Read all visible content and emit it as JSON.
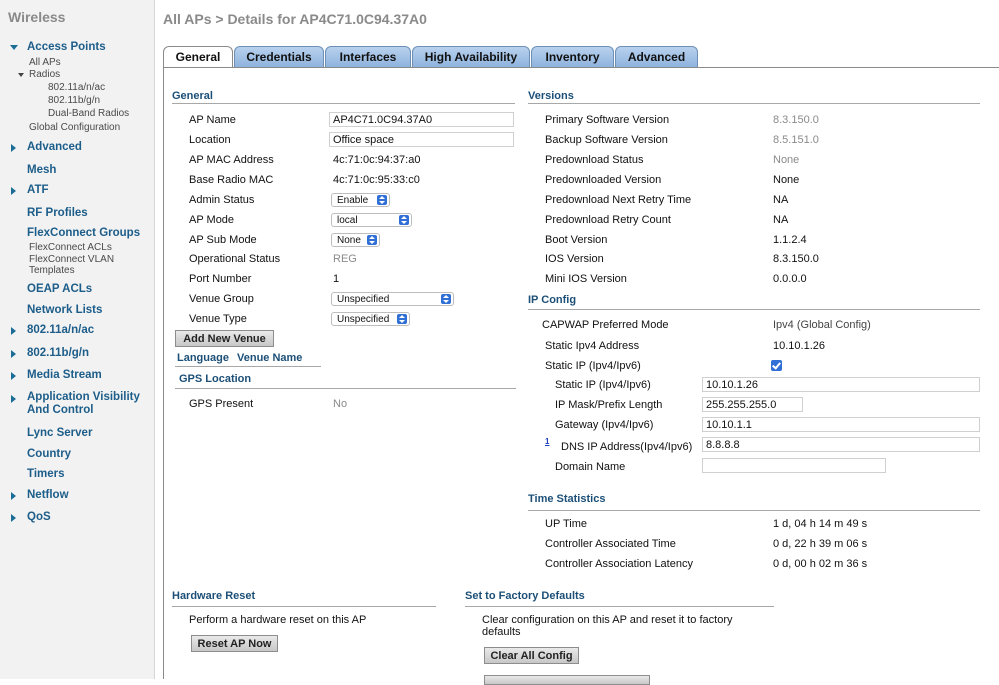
{
  "sidebar": {
    "title": "Wireless",
    "access_points": "Access Points",
    "all_aps": "All APs",
    "radios": "Radios",
    "radio_a": "802.11a/n/ac",
    "radio_b": "802.11b/g/n",
    "dual_band": "Dual-Band Radios",
    "global_config": "Global Configuration",
    "advanced": "Advanced",
    "mesh": "Mesh",
    "atf": "ATF",
    "rf_profiles": "RF Profiles",
    "flexconnect_groups": "FlexConnect Groups",
    "flexconnect_acls": "FlexConnect ACLs",
    "flexconnect_vlan_1": "FlexConnect VLAN",
    "flexconnect_vlan_2": "Templates",
    "oeap_acls": "OEAP ACLs",
    "network_lists": "Network Lists",
    "a_n_ac": "802.11a/n/ac",
    "b_g_n": "802.11b/g/n",
    "media_stream": "Media Stream",
    "avc_1": "Application Visibility",
    "avc_2": "And Control",
    "lync": "Lync Server",
    "country": "Country",
    "timers": "Timers",
    "netflow": "Netflow",
    "qos": "QoS"
  },
  "page_title": "All APs > Details for AP4C71.0C94.37A0",
  "tabs": [
    "General",
    "Credentials",
    "Interfaces",
    "High Availability",
    "Inventory",
    "Advanced"
  ],
  "general": {
    "heading": "General",
    "ap_name_label": "AP Name",
    "ap_name": "AP4C71.0C94.37A0",
    "location_label": "Location",
    "location": "Office space",
    "mac_label": "AP MAC Address",
    "mac": "4c:71:0c:94:37:a0",
    "base_mac_label": "Base Radio MAC",
    "base_mac": "4c:71:0c:95:33:c0",
    "admin_status_label": "Admin Status",
    "admin_status": "Enable",
    "ap_mode_label": "AP Mode",
    "ap_mode": "local",
    "ap_sub_mode_label": "AP Sub Mode",
    "ap_sub_mode": "None",
    "op_status_label": "Operational Status",
    "op_status": "REG",
    "port_label": "Port Number",
    "port": "1",
    "venue_group_label": "Venue Group",
    "venue_group": "Unspecified",
    "venue_type_label": "Venue Type",
    "venue_type": "Unspecified",
    "add_venue_button": "Add New Venue",
    "language_col": "Language",
    "venue_name_col": "Venue Name",
    "gps_heading": "GPS Location",
    "gps_present_label": "GPS Present",
    "gps_present": "No"
  },
  "versions": {
    "heading": "Versions",
    "primary_label": "Primary Software Version",
    "primary": "8.3.150.0",
    "backup_label": "Backup Software Version",
    "backup": "8.5.151.0",
    "predl_status_label": "Predownload Status",
    "predl_status": "None",
    "predl_version_label": "Predownloaded Version",
    "predl_version": "None",
    "predl_next_label": "Predownload Next Retry Time",
    "predl_next": "NA",
    "predl_count_label": "Predownload Retry Count",
    "predl_count": "NA",
    "boot_label": "Boot Version",
    "boot": "1.1.2.4",
    "ios_label": "IOS Version",
    "ios": "8.3.150.0",
    "mini_ios_label": "Mini IOS Version",
    "mini_ios": "0.0.0.0"
  },
  "ip_config": {
    "heading": "IP Config",
    "capwap_label": "CAPWAP Preferred Mode",
    "capwap": "Ipv4 (Global Config)",
    "static_ipv4_label": "Static Ipv4 Address",
    "static_ipv4": "10.10.1.26",
    "static_ip_chk_label": "Static IP (Ipv4/Ipv6)",
    "static_ip_label": "Static IP (Ipv4/Ipv6)",
    "static_ip": "10.10.1.26",
    "mask_label": "IP Mask/Prefix Length",
    "mask": "255.255.255.0",
    "gateway_label": "Gateway (Ipv4/Ipv6)",
    "gateway": "10.10.1.1",
    "footnote": "1",
    "dns_label": "DNS IP Address(Ipv4/Ipv6)",
    "dns": "8.8.8.8",
    "domain_label": "Domain Name",
    "domain": ""
  },
  "time_stats": {
    "heading": "Time Statistics",
    "up_label": "UP Time",
    "up": "1 d, 04 h 14 m 49 s",
    "assoc_label": "Controller Associated Time",
    "assoc": "0 d, 22 h 39 m 06 s",
    "latency_label": "Controller Association Latency",
    "latency": "0 d, 00 h 02 m 36 s"
  },
  "hardware_reset": {
    "heading": "Hardware Reset",
    "desc": "Perform a hardware reset on this AP",
    "button": "Reset AP Now"
  },
  "factory": {
    "heading": "Set to Factory Defaults",
    "desc_1": "Clear configuration on this AP and reset it to factory",
    "desc_2": "defaults",
    "button": "Clear All Config"
  }
}
